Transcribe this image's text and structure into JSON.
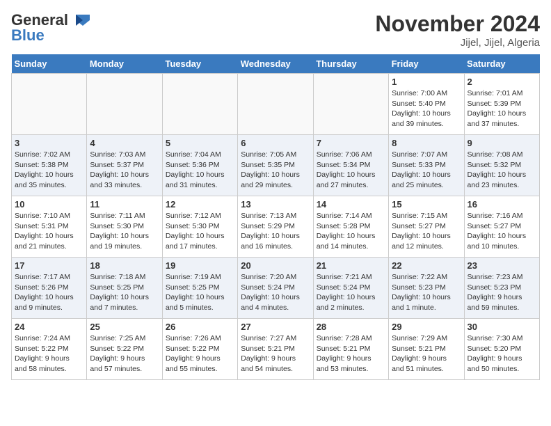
{
  "header": {
    "logo_general": "General",
    "logo_blue": "Blue",
    "month_title": "November 2024",
    "location": "Jijel, Jijel, Algeria"
  },
  "days_of_week": [
    "Sunday",
    "Monday",
    "Tuesday",
    "Wednesday",
    "Thursday",
    "Friday",
    "Saturday"
  ],
  "weeks": [
    {
      "row_class": "normal",
      "days": [
        {
          "num": "",
          "class": "empty",
          "info": ""
        },
        {
          "num": "",
          "class": "empty",
          "info": ""
        },
        {
          "num": "",
          "class": "empty",
          "info": ""
        },
        {
          "num": "",
          "class": "empty",
          "info": ""
        },
        {
          "num": "",
          "class": "empty",
          "info": ""
        },
        {
          "num": "1",
          "class": "normal",
          "info": "Sunrise: 7:00 AM\nSunset: 5:40 PM\nDaylight: 10 hours\nand 39 minutes."
        },
        {
          "num": "2",
          "class": "normal",
          "info": "Sunrise: 7:01 AM\nSunset: 5:39 PM\nDaylight: 10 hours\nand 37 minutes."
        }
      ]
    },
    {
      "row_class": "alt",
      "days": [
        {
          "num": "3",
          "class": "alt",
          "info": "Sunrise: 7:02 AM\nSunset: 5:38 PM\nDaylight: 10 hours\nand 35 minutes."
        },
        {
          "num": "4",
          "class": "alt",
          "info": "Sunrise: 7:03 AM\nSunset: 5:37 PM\nDaylight: 10 hours\nand 33 minutes."
        },
        {
          "num": "5",
          "class": "alt",
          "info": "Sunrise: 7:04 AM\nSunset: 5:36 PM\nDaylight: 10 hours\nand 31 minutes."
        },
        {
          "num": "6",
          "class": "alt",
          "info": "Sunrise: 7:05 AM\nSunset: 5:35 PM\nDaylight: 10 hours\nand 29 minutes."
        },
        {
          "num": "7",
          "class": "alt",
          "info": "Sunrise: 7:06 AM\nSunset: 5:34 PM\nDaylight: 10 hours\nand 27 minutes."
        },
        {
          "num": "8",
          "class": "alt",
          "info": "Sunrise: 7:07 AM\nSunset: 5:33 PM\nDaylight: 10 hours\nand 25 minutes."
        },
        {
          "num": "9",
          "class": "alt",
          "info": "Sunrise: 7:08 AM\nSunset: 5:32 PM\nDaylight: 10 hours\nand 23 minutes."
        }
      ]
    },
    {
      "row_class": "normal",
      "days": [
        {
          "num": "10",
          "class": "normal",
          "info": "Sunrise: 7:10 AM\nSunset: 5:31 PM\nDaylight: 10 hours\nand 21 minutes."
        },
        {
          "num": "11",
          "class": "normal",
          "info": "Sunrise: 7:11 AM\nSunset: 5:30 PM\nDaylight: 10 hours\nand 19 minutes."
        },
        {
          "num": "12",
          "class": "normal",
          "info": "Sunrise: 7:12 AM\nSunset: 5:30 PM\nDaylight: 10 hours\nand 17 minutes."
        },
        {
          "num": "13",
          "class": "normal",
          "info": "Sunrise: 7:13 AM\nSunset: 5:29 PM\nDaylight: 10 hours\nand 16 minutes."
        },
        {
          "num": "14",
          "class": "normal",
          "info": "Sunrise: 7:14 AM\nSunset: 5:28 PM\nDaylight: 10 hours\nand 14 minutes."
        },
        {
          "num": "15",
          "class": "normal",
          "info": "Sunrise: 7:15 AM\nSunset: 5:27 PM\nDaylight: 10 hours\nand 12 minutes."
        },
        {
          "num": "16",
          "class": "normal",
          "info": "Sunrise: 7:16 AM\nSunset: 5:27 PM\nDaylight: 10 hours\nand 10 minutes."
        }
      ]
    },
    {
      "row_class": "alt",
      "days": [
        {
          "num": "17",
          "class": "alt",
          "info": "Sunrise: 7:17 AM\nSunset: 5:26 PM\nDaylight: 10 hours\nand 9 minutes."
        },
        {
          "num": "18",
          "class": "alt",
          "info": "Sunrise: 7:18 AM\nSunset: 5:25 PM\nDaylight: 10 hours\nand 7 minutes."
        },
        {
          "num": "19",
          "class": "alt",
          "info": "Sunrise: 7:19 AM\nSunset: 5:25 PM\nDaylight: 10 hours\nand 5 minutes."
        },
        {
          "num": "20",
          "class": "alt",
          "info": "Sunrise: 7:20 AM\nSunset: 5:24 PM\nDaylight: 10 hours\nand 4 minutes."
        },
        {
          "num": "21",
          "class": "alt",
          "info": "Sunrise: 7:21 AM\nSunset: 5:24 PM\nDaylight: 10 hours\nand 2 minutes."
        },
        {
          "num": "22",
          "class": "alt",
          "info": "Sunrise: 7:22 AM\nSunset: 5:23 PM\nDaylight: 10 hours\nand 1 minute."
        },
        {
          "num": "23",
          "class": "alt",
          "info": "Sunrise: 7:23 AM\nSunset: 5:23 PM\nDaylight: 9 hours\nand 59 minutes."
        }
      ]
    },
    {
      "row_class": "normal",
      "days": [
        {
          "num": "24",
          "class": "normal",
          "info": "Sunrise: 7:24 AM\nSunset: 5:22 PM\nDaylight: 9 hours\nand 58 minutes."
        },
        {
          "num": "25",
          "class": "normal",
          "info": "Sunrise: 7:25 AM\nSunset: 5:22 PM\nDaylight: 9 hours\nand 57 minutes."
        },
        {
          "num": "26",
          "class": "normal",
          "info": "Sunrise: 7:26 AM\nSunset: 5:22 PM\nDaylight: 9 hours\nand 55 minutes."
        },
        {
          "num": "27",
          "class": "normal",
          "info": "Sunrise: 7:27 AM\nSunset: 5:21 PM\nDaylight: 9 hours\nand 54 minutes."
        },
        {
          "num": "28",
          "class": "normal",
          "info": "Sunrise: 7:28 AM\nSunset: 5:21 PM\nDaylight: 9 hours\nand 53 minutes."
        },
        {
          "num": "29",
          "class": "normal",
          "info": "Sunrise: 7:29 AM\nSunset: 5:21 PM\nDaylight: 9 hours\nand 51 minutes."
        },
        {
          "num": "30",
          "class": "normal",
          "info": "Sunrise: 7:30 AM\nSunset: 5:20 PM\nDaylight: 9 hours\nand 50 minutes."
        }
      ]
    }
  ]
}
